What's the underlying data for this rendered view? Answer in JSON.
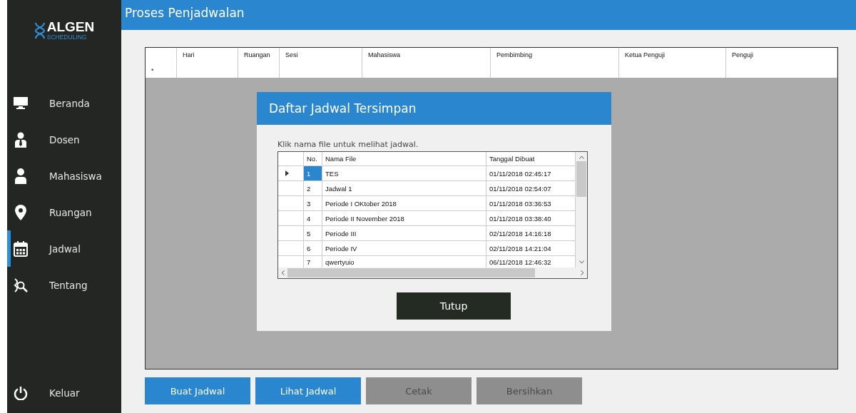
{
  "sidebar": {
    "logo": {
      "title": "ALGEN",
      "subtitle": "SCHEDULING"
    },
    "items": [
      {
        "label": "Beranda",
        "kind": "monitor",
        "selected": false
      },
      {
        "label": "Dosen",
        "kind": "lecturer",
        "selected": false
      },
      {
        "label": "Mahasiswa",
        "kind": "person",
        "selected": false
      },
      {
        "label": "Ruangan",
        "kind": "pin",
        "selected": false
      },
      {
        "label": "Jadwal",
        "kind": "calendar",
        "selected": true
      },
      {
        "label": "Tentang",
        "kind": "about",
        "selected": false
      }
    ],
    "logout": "Keluar"
  },
  "header": {
    "title": "Proses Penjadwalan"
  },
  "table": {
    "new_row_marker": "*",
    "columns": [
      "Hari",
      "Ruangan",
      "Sesi",
      "Mahasiswa",
      "Pembimbing",
      "Ketua Penguji",
      "Penguji"
    ]
  },
  "dialog": {
    "title": "Daftar Jadwal Tersimpan",
    "hint": "Klik nama file untuk melihat jadwal.",
    "columns": [
      "No.",
      "Nama File",
      "Tanggal Dibuat"
    ],
    "rows": [
      {
        "no": "1",
        "name": "TES",
        "date": "01/11/2018 02:45:17",
        "selected": true
      },
      {
        "no": "2",
        "name": "Jadwal 1",
        "date": "01/11/2018 02:54:07",
        "selected": false
      },
      {
        "no": "3",
        "name": "Periode I OKtober 2018",
        "date": "01/11/2018 03:36:53",
        "selected": false
      },
      {
        "no": "4",
        "name": "Periode II November 2018",
        "date": "01/11/2018 03:38:40",
        "selected": false
      },
      {
        "no": "5",
        "name": "Periode III",
        "date": "02/11/2018 14:16:18",
        "selected": false
      },
      {
        "no": "6",
        "name": "Periode IV",
        "date": "02/11/2018 14:21:04",
        "selected": false
      },
      {
        "no": "7",
        "name": "qwertyuio",
        "date": "06/11/2018 12:46:32",
        "selected": false
      }
    ],
    "close_button": "Tutup"
  },
  "buttons": [
    {
      "label": "Buat Jadwal",
      "disabled": false
    },
    {
      "label": "Lihat Jadwal",
      "disabled": false
    },
    {
      "label": "Cetak",
      "disabled": true
    },
    {
      "label": "Bersihkan",
      "disabled": true
    }
  ]
}
